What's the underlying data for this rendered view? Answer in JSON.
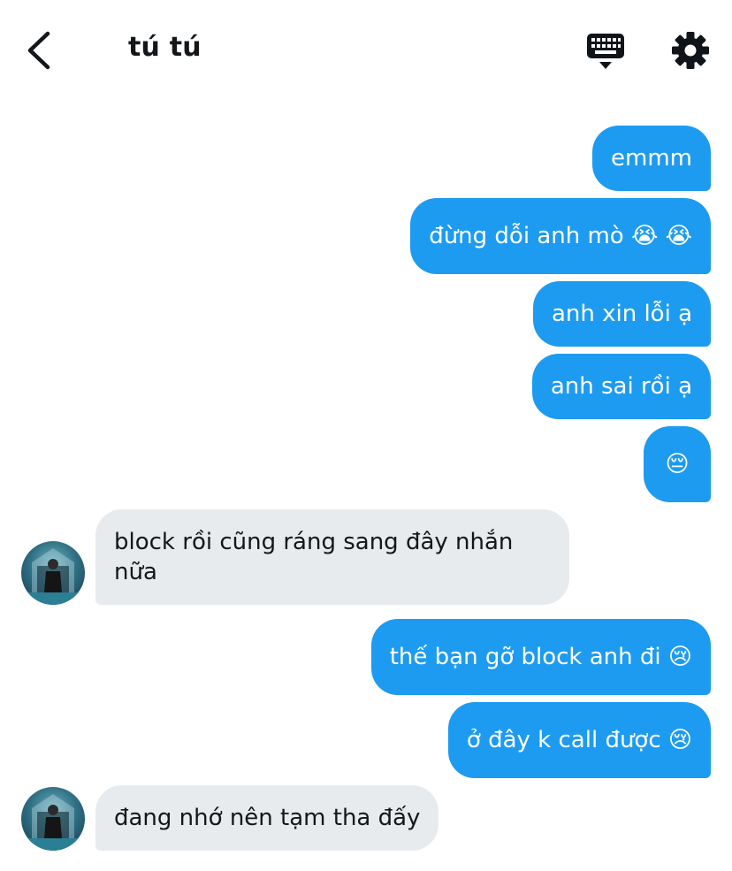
{
  "header": {
    "title": "tú tú",
    "back_icon": "chevron-left-icon",
    "keyboard_icon": "keyboard-icon",
    "settings_icon": "gear-icon"
  },
  "messages": [
    {
      "from": "me",
      "text": "emmm"
    },
    {
      "from": "me",
      "text": "đừng dỗi anh mò 😭 😭"
    },
    {
      "from": "me",
      "text": "anh xin lỗi ạ"
    },
    {
      "from": "me",
      "text": "anh sai rồi ạ"
    },
    {
      "from": "me",
      "text": "😔"
    },
    {
      "from": "them",
      "text": "block rồi cũng ráng sang đây nhắn nữa"
    },
    {
      "from": "me",
      "text": "thế bạn gỡ block anh đi 😢"
    },
    {
      "from": "me",
      "text": "ở đây k call được 😢"
    },
    {
      "from": "them",
      "text": "đang nhớ nên tạm tha đấy"
    }
  ],
  "colors": {
    "sent_bubble": "#1d9bf0",
    "received_bubble": "#e7ebee",
    "text_dark": "#14171a"
  }
}
